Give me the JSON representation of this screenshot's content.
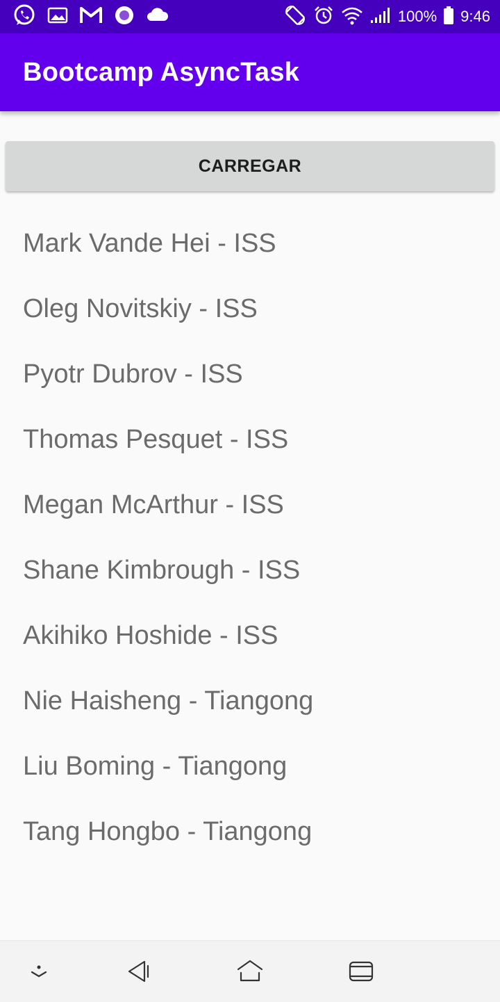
{
  "status_bar": {
    "battery": "100%",
    "time": "9:46",
    "left_icons": [
      "whatsapp-icon",
      "gallery-icon",
      "gmail-icon",
      "circle-app-icon",
      "cloud-icon"
    ],
    "right_icons": [
      "rotate-icon",
      "alarm-icon",
      "wifi-icon",
      "signal-icon",
      "battery-icon"
    ]
  },
  "app_bar": {
    "title": "Bootcamp AsyncTask"
  },
  "main": {
    "load_button_label": "CARREGAR",
    "astronauts": [
      "Mark Vande Hei - ISS",
      "Oleg Novitskiy - ISS",
      "Pyotr Dubrov - ISS",
      "Thomas Pesquet - ISS",
      "Megan McArthur - ISS",
      "Shane Kimbrough - ISS",
      "Akihiko Hoshide - ISS",
      "Nie Haisheng - Tiangong",
      "Liu Boming - Tiangong",
      "Tang Hongbo - Tiangong"
    ]
  },
  "nav_bar": {
    "icons": [
      "hide-nav-icon",
      "back-icon",
      "home-icon",
      "recents-icon"
    ]
  },
  "colors": {
    "status_bar": "#4400bd",
    "app_bar": "#6200ee",
    "button": "#d6d7d7",
    "list_text": "#6b6b6b",
    "background": "#fafafa"
  }
}
